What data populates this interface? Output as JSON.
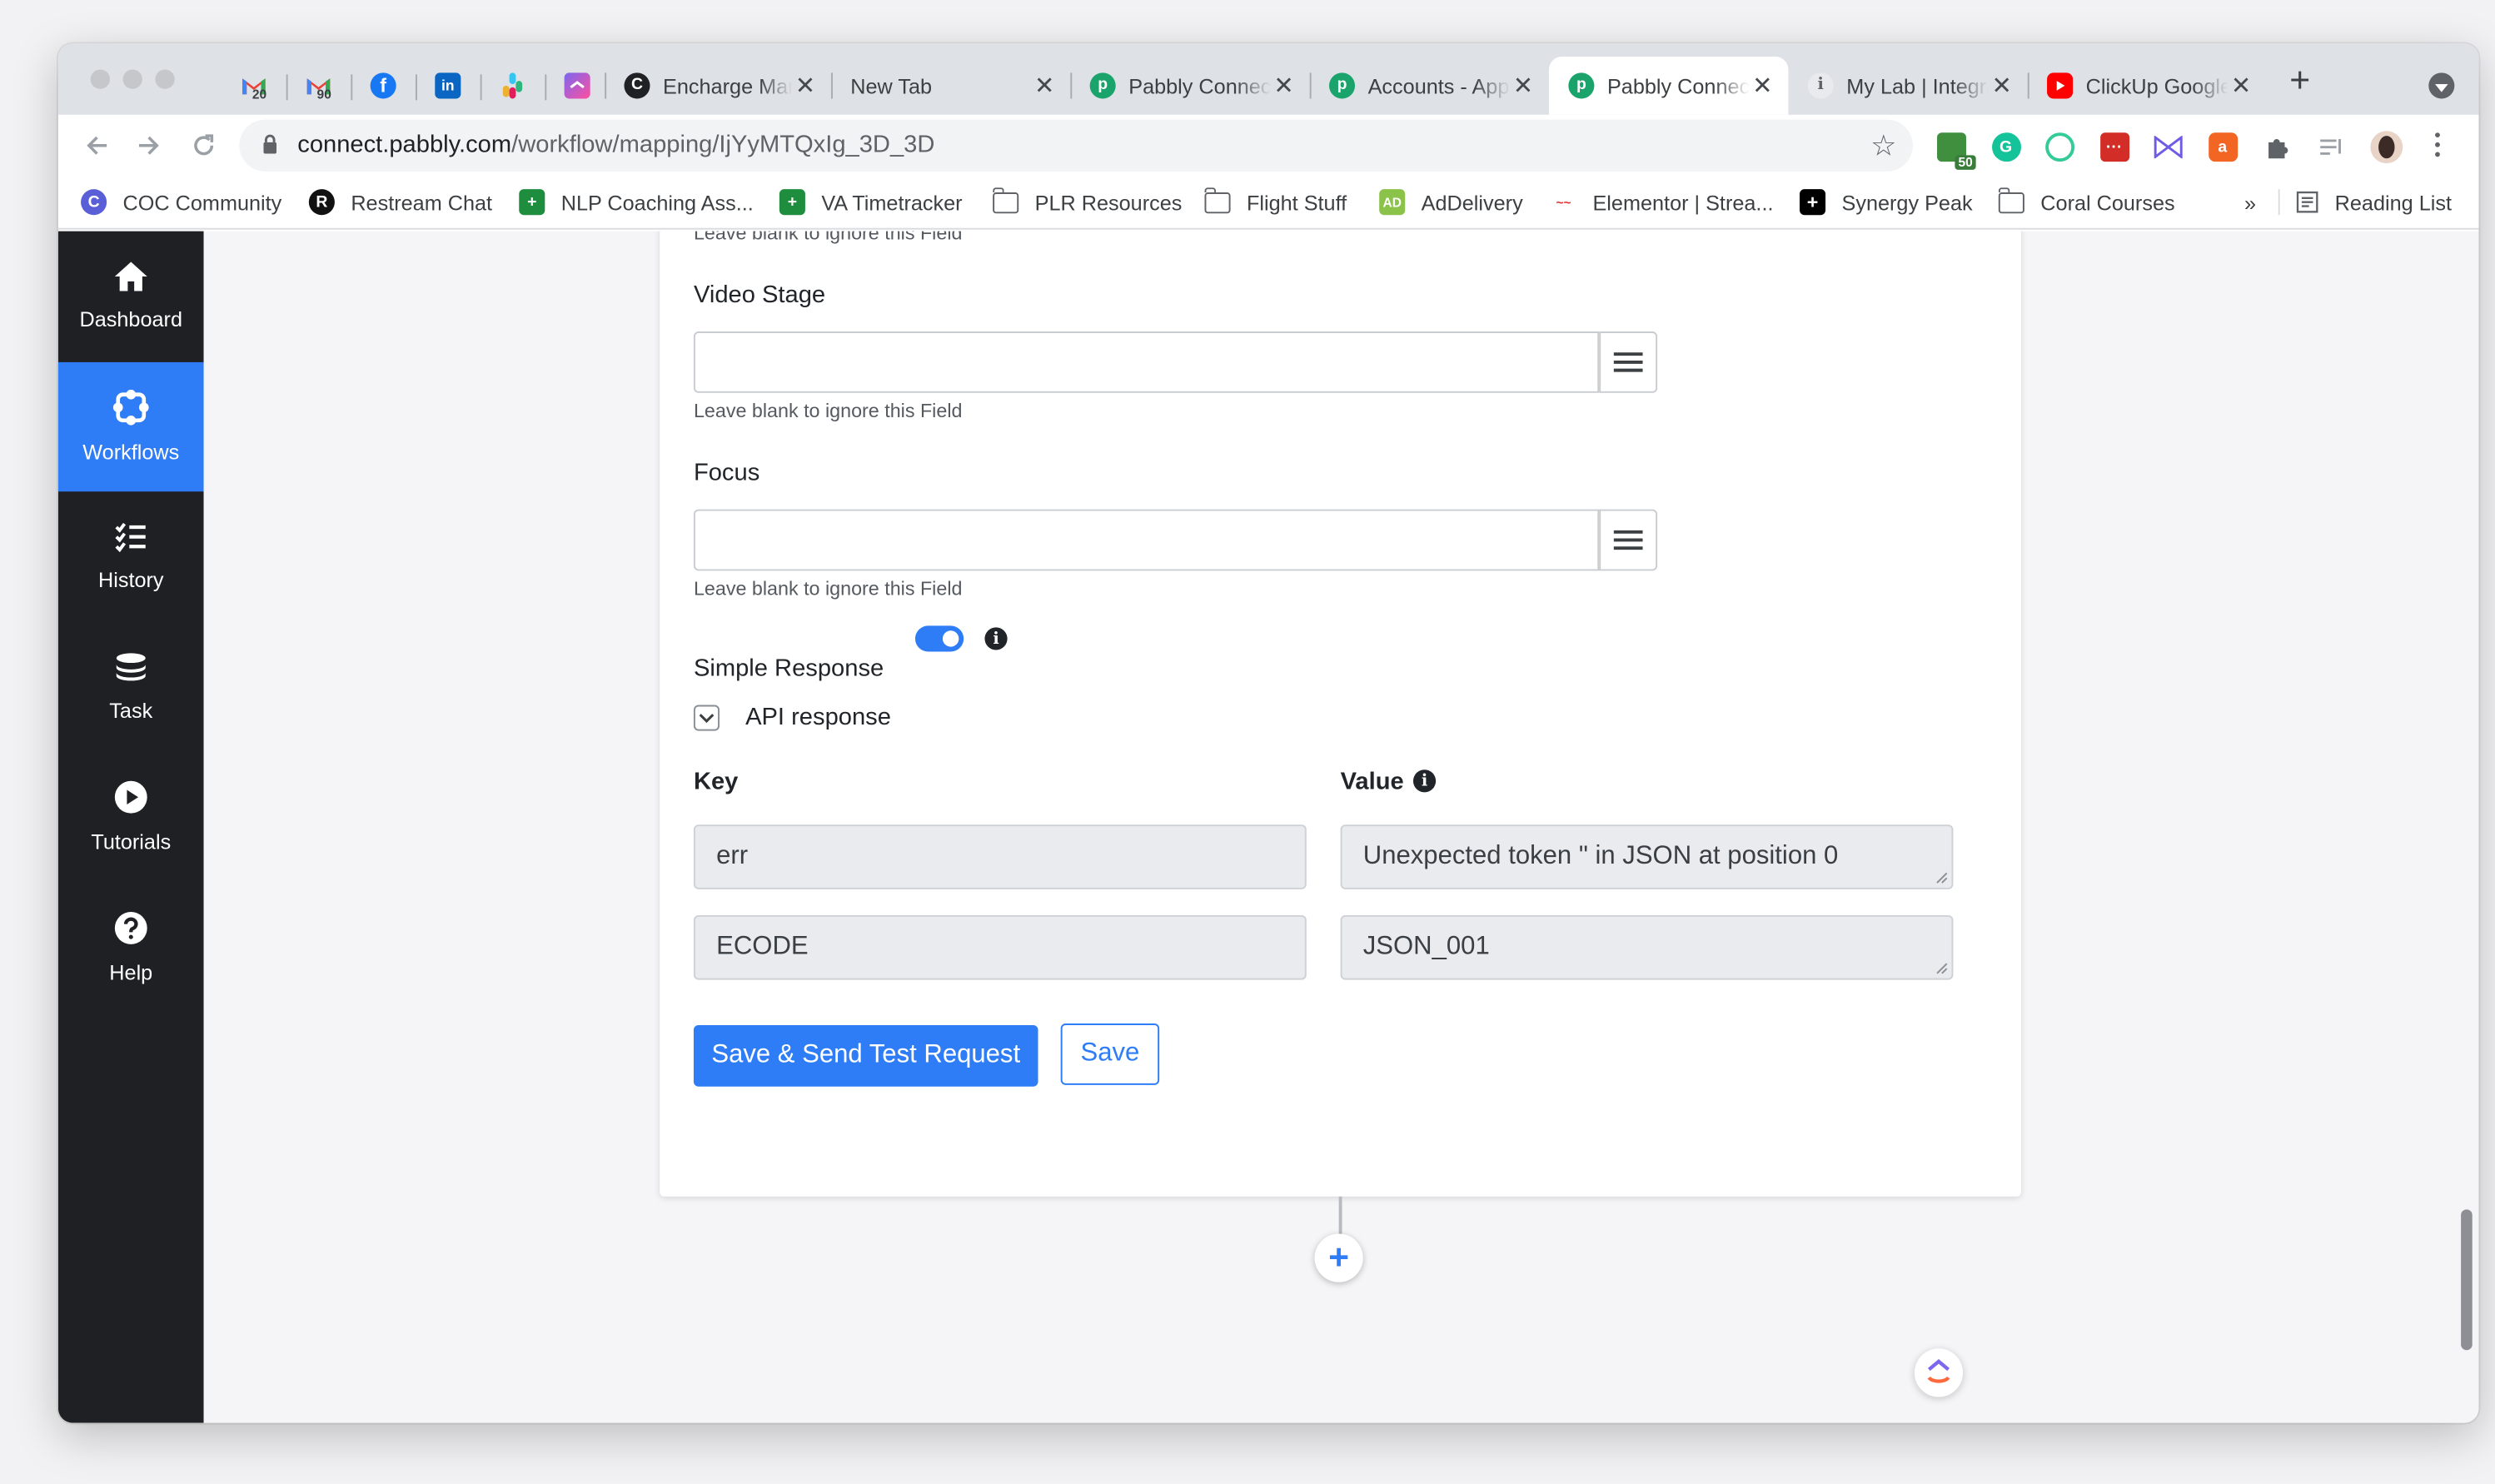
{
  "browser": {
    "pinned_tabs": [
      {
        "icon": "gmail-icon",
        "badge": "20"
      },
      {
        "icon": "gmail-icon",
        "badge": "90"
      },
      {
        "icon": "facebook-icon"
      },
      {
        "icon": "linkedin-icon"
      },
      {
        "icon": "slack-icon"
      },
      {
        "icon": "clickup-icon"
      }
    ],
    "tabs": [
      {
        "title": "Encharge Marketing",
        "icon": "encharge-icon",
        "active": false
      },
      {
        "title": "New Tab",
        "icon": "",
        "active": false
      },
      {
        "title": "Pabbly Connect",
        "icon": "pabbly-icon",
        "active": false
      },
      {
        "title": "Accounts - Apps",
        "icon": "pabbly-icon",
        "active": false
      },
      {
        "title": "Pabbly Connect",
        "icon": "pabbly-icon",
        "active": true
      },
      {
        "title": "My Lab | Integrations",
        "icon": "info-icon",
        "active": false
      },
      {
        "title": "ClickUp Google",
        "icon": "youtube-icon",
        "active": false
      }
    ],
    "new_tab_label": "+",
    "url_host": "connect.pabbly.com",
    "url_path": "/workflow/mapping/IjYyMTQxIg_3D_3D",
    "extension_badge": "50",
    "bookmarks": [
      {
        "label": "COC Community",
        "icon": "coc-icon"
      },
      {
        "label": "Restream Chat",
        "icon": "restream-icon"
      },
      {
        "label": "NLP Coaching Ass...",
        "icon": "sheets-icon"
      },
      {
        "label": "VA Timetracker",
        "icon": "sheets-icon"
      },
      {
        "label": "PLR Resources",
        "icon": "folder-icon"
      },
      {
        "label": "Flight Stuff",
        "icon": "folder-icon"
      },
      {
        "label": "AdDelivery",
        "icon": "addelivery-icon"
      },
      {
        "label": "Elementor | Strea...",
        "icon": "elementor-icon"
      },
      {
        "label": "Synergy Peak",
        "icon": "synergy-icon"
      },
      {
        "label": "Coral Courses",
        "icon": "folder-icon"
      }
    ],
    "bookmarks_more": "»",
    "reading_list": "Reading List"
  },
  "sidebar": {
    "items": [
      {
        "label": "Dashboard",
        "icon": "home-icon",
        "active": false
      },
      {
        "label": "Workflows",
        "icon": "workflow-icon",
        "active": true
      },
      {
        "label": "History",
        "icon": "history-icon",
        "active": false
      },
      {
        "label": "Task",
        "icon": "task-icon",
        "active": false
      },
      {
        "label": "Tutorials",
        "icon": "play-icon",
        "active": false
      },
      {
        "label": "Help",
        "icon": "help-icon",
        "active": false
      }
    ]
  },
  "form": {
    "top_hint": "Leave blank to ignore this Field",
    "fields": [
      {
        "label": "Video Stage",
        "value": "",
        "hint": "Leave blank to ignore this Field"
      },
      {
        "label": "Focus",
        "value": "",
        "hint": "Leave blank to ignore this Field"
      }
    ],
    "simple_response_label": "Simple Response",
    "simple_response_on": true,
    "info_glyph": "i",
    "api_response_label": "API response",
    "key_header": "Key",
    "value_header": "Value",
    "rows": [
      {
        "key": "err",
        "value": "Unexpected token \" in JSON at position 0"
      },
      {
        "key": "ECODE",
        "value": "JSON_001"
      }
    ],
    "save_test_label": "Save & Send Test Request",
    "save_label": "Save",
    "add_step_label": "+"
  },
  "colors": {
    "accent": "#2f7df6",
    "sidebar_bg": "#1f2023"
  }
}
